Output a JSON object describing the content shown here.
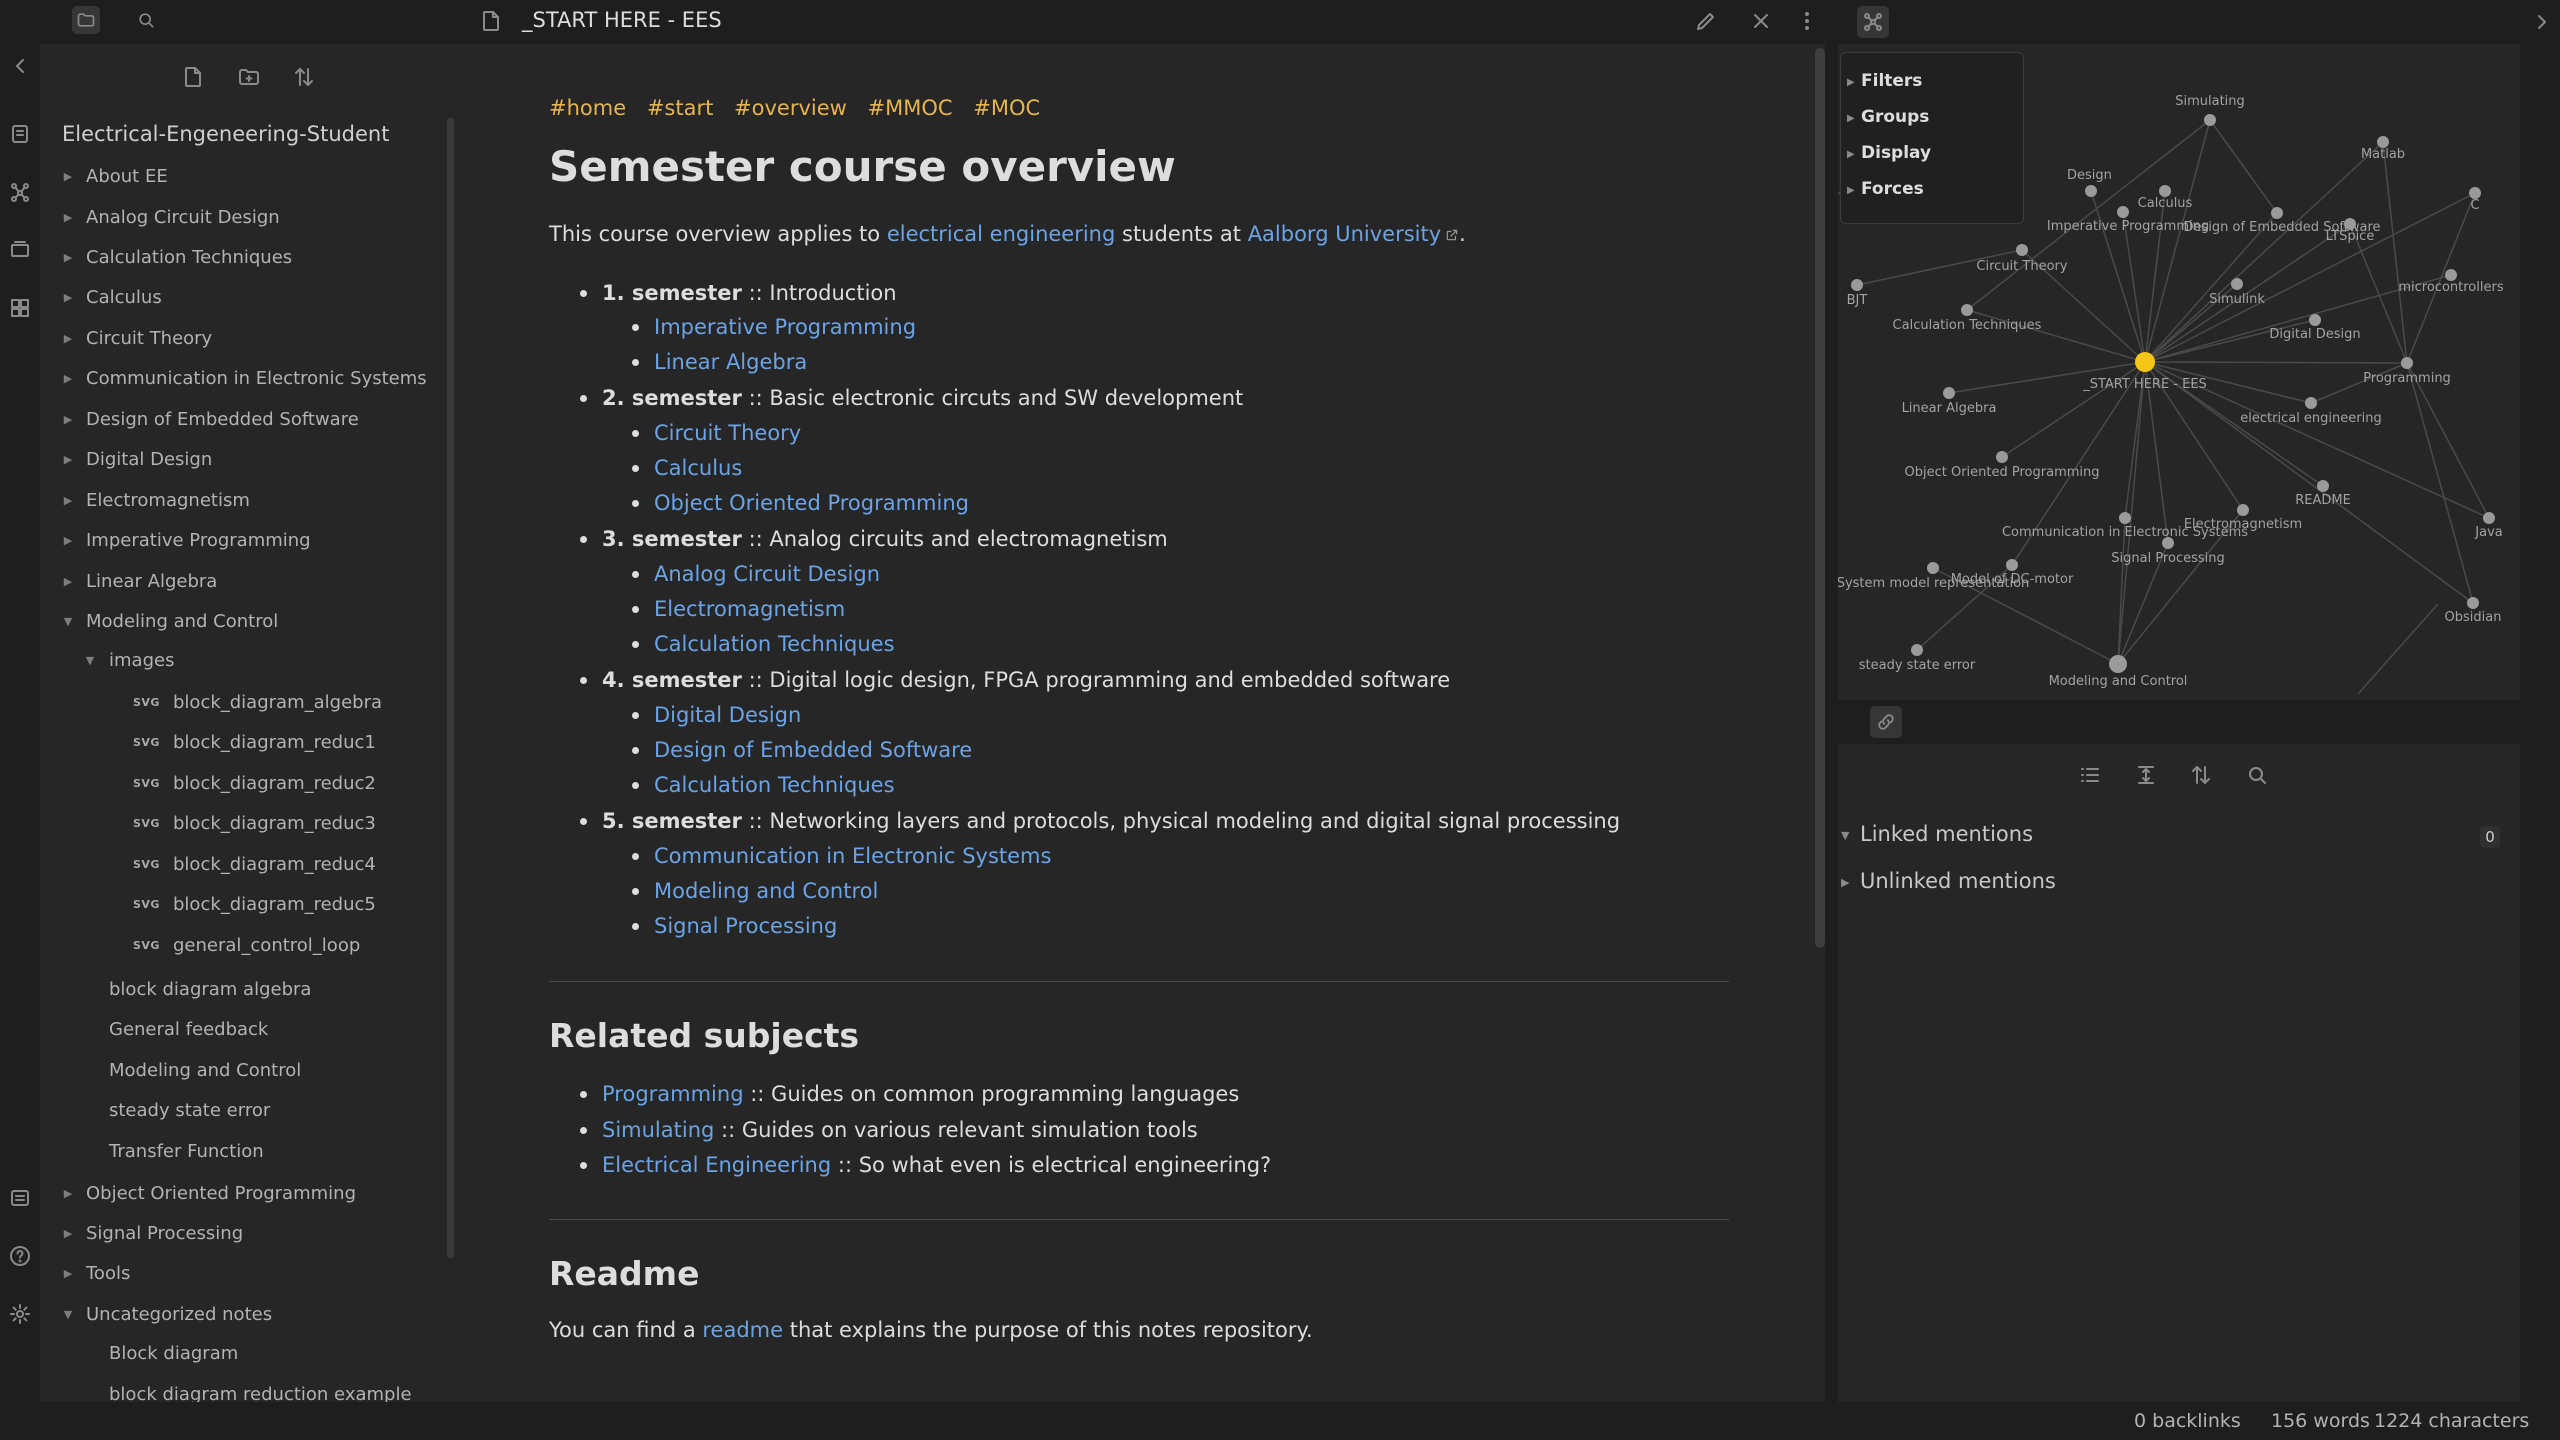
{
  "sidebar": {
    "vault_name": "Electrical-Engeneering-Student",
    "items": [
      {
        "label": "About EE"
      },
      {
        "label": "Analog Circuit Design"
      },
      {
        "label": "Calculation Techniques"
      },
      {
        "label": "Calculus"
      },
      {
        "label": "Circuit Theory"
      },
      {
        "label": "Communication in Electronic Systems"
      },
      {
        "label": "Design of Embedded Software"
      },
      {
        "label": "Digital Design"
      },
      {
        "label": "Electromagnetism"
      },
      {
        "label": "Imperative Programming"
      },
      {
        "label": "Linear Algebra"
      },
      {
        "label": "Modeling and Control"
      },
      {
        "label": "images"
      },
      {
        "label": "block_diagram_algebra",
        "badge": "SVG"
      },
      {
        "label": "block_diagram_reduc1",
        "badge": "SVG"
      },
      {
        "label": "block_diagram_reduc2",
        "badge": "SVG"
      },
      {
        "label": "block_diagram_reduc3",
        "badge": "SVG"
      },
      {
        "label": "block_diagram_reduc4",
        "badge": "SVG"
      },
      {
        "label": "block_diagram_reduc5",
        "badge": "SVG"
      },
      {
        "label": "general_control_loop",
        "badge": "SVG"
      },
      {
        "label": "block diagram algebra"
      },
      {
        "label": "General feedback"
      },
      {
        "label": "Modeling and Control"
      },
      {
        "label": "steady state error"
      },
      {
        "label": "Transfer Function"
      },
      {
        "label": "Object Oriented Programming"
      },
      {
        "label": "Signal Processing"
      },
      {
        "label": "Tools"
      },
      {
        "label": "Uncategorized notes"
      },
      {
        "label": "Block diagram"
      },
      {
        "label": "block diagram reduction example"
      }
    ]
  },
  "editor": {
    "tab_title": "_START HERE - EES",
    "tags": [
      "#home",
      "#start",
      "#overview",
      "#MMOC",
      "#MOC"
    ],
    "heading": "Semester course overview",
    "intro": {
      "pre": "This course overview applies to ",
      "link1": "electrical engineering",
      "mid": " students at ",
      "link2": "Aalborg University",
      "post": "."
    },
    "semesters": [
      {
        "label": "1. semester",
        "desc": " :: Introduction",
        "courses": [
          "Imperative Programming",
          "Linear Algebra"
        ]
      },
      {
        "label": "2. semester",
        "desc": " :: Basic electronic circuts and SW development",
        "courses": [
          "Circuit Theory",
          "Calculus",
          "Object Oriented Programming"
        ]
      },
      {
        "label": "3. semester",
        "desc": " :: Analog circuits and electromagnetism",
        "courses": [
          "Analog Circuit Design",
          "Electromagnetism",
          "Calculation Techniques"
        ]
      },
      {
        "label": "4. semester",
        "desc": " :: Digital logic design, FPGA programming and embedded software",
        "courses": [
          "Digital Design",
          "Design of Embedded Software",
          "Calculation Techniques"
        ]
      },
      {
        "label": "5. semester",
        "desc": " :: Networking layers and protocols, physical modeling and digital signal processing",
        "courses": [
          "Communication in Electronic Systems",
          "Modeling and Control",
          "Signal Processing"
        ]
      }
    ],
    "related_heading": "Related subjects",
    "related": [
      {
        "link": "Programming",
        "desc": " :: Guides on common programming languages"
      },
      {
        "link": "Simulating",
        "desc": " :: Guides on various relevant simulation tools"
      },
      {
        "link": "Electrical Engineering",
        "desc": " :: So what even is electrical engineering?"
      }
    ],
    "readme_heading": "Readme",
    "readme": {
      "pre": "You can find a ",
      "link": "readme",
      "post": " that explains the purpose of this notes repository."
    }
  },
  "graph": {
    "controls": [
      "Filters",
      "Groups",
      "Display",
      "Forces"
    ],
    "center_node": "_START HERE - EES",
    "nodes": [
      "Simulating",
      "Matlab",
      "C",
      "Design",
      "Imperative Programming",
      "Calculus",
      "Design of Embedded Software",
      "LTSpice",
      "Circuit Theory",
      "microcontrollers",
      "BJT",
      "Simulink",
      "Calculation Techniques",
      "Digital Design",
      "Programming",
      "Linear Algebra",
      "electrical engineering",
      "Object Oriented Programming",
      "README",
      "Java",
      "Communication in Electronic Systems",
      "Electromagnetism",
      "Model of DC-motor",
      "Signal Processing",
      "System model representation",
      "Obsidian",
      "steady state error",
      "Modeling and Control"
    ]
  },
  "backlinks": {
    "linked": "Linked mentions",
    "linked_count": "0",
    "unlinked": "Unlinked mentions"
  },
  "status": {
    "backlinks": "0 backlinks",
    "words": "156 words",
    "chars": "1224 characters"
  },
  "colors": {
    "accent_link": "#6ba4e6",
    "tag": "#e6b450",
    "active_node": "#f5c518"
  }
}
